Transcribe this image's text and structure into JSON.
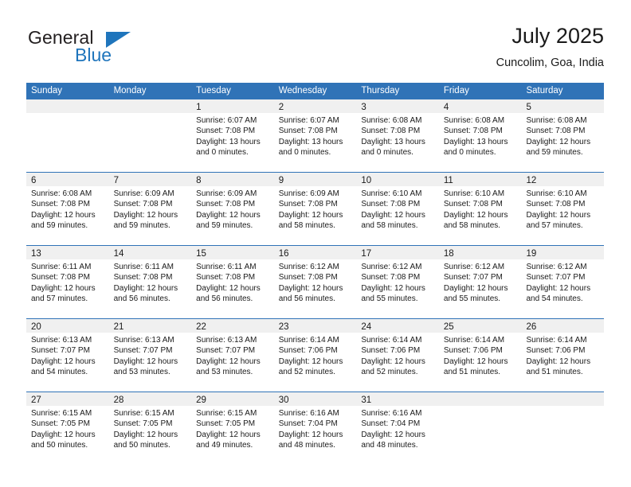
{
  "brand": {
    "name_top": "General",
    "name_bottom": "Blue",
    "triangle_icon": "triangle-icon",
    "accent_color": "#1f75bc"
  },
  "header": {
    "title": "July 2025",
    "location": "Cuncolim, Goa, India"
  },
  "theme": {
    "header_blue": "#3073b7",
    "day_strip_gray": "#f0f0f0",
    "text": "#1a1a1a"
  },
  "calendar": {
    "weekday_headers": [
      "Sunday",
      "Monday",
      "Tuesday",
      "Wednesday",
      "Thursday",
      "Friday",
      "Saturday"
    ],
    "weeks": [
      [
        {
          "day": "",
          "sunrise": "",
          "sunset": "",
          "daylight_line1": "",
          "daylight_line2": ""
        },
        {
          "day": "",
          "sunrise": "",
          "sunset": "",
          "daylight_line1": "",
          "daylight_line2": ""
        },
        {
          "day": "1",
          "sunrise": "Sunrise: 6:07 AM",
          "sunset": "Sunset: 7:08 PM",
          "daylight_line1": "Daylight: 13 hours",
          "daylight_line2": "and 0 minutes."
        },
        {
          "day": "2",
          "sunrise": "Sunrise: 6:07 AM",
          "sunset": "Sunset: 7:08 PM",
          "daylight_line1": "Daylight: 13 hours",
          "daylight_line2": "and 0 minutes."
        },
        {
          "day": "3",
          "sunrise": "Sunrise: 6:08 AM",
          "sunset": "Sunset: 7:08 PM",
          "daylight_line1": "Daylight: 13 hours",
          "daylight_line2": "and 0 minutes."
        },
        {
          "day": "4",
          "sunrise": "Sunrise: 6:08 AM",
          "sunset": "Sunset: 7:08 PM",
          "daylight_line1": "Daylight: 13 hours",
          "daylight_line2": "and 0 minutes."
        },
        {
          "day": "5",
          "sunrise": "Sunrise: 6:08 AM",
          "sunset": "Sunset: 7:08 PM",
          "daylight_line1": "Daylight: 12 hours",
          "daylight_line2": "and 59 minutes."
        }
      ],
      [
        {
          "day": "6",
          "sunrise": "Sunrise: 6:08 AM",
          "sunset": "Sunset: 7:08 PM",
          "daylight_line1": "Daylight: 12 hours",
          "daylight_line2": "and 59 minutes."
        },
        {
          "day": "7",
          "sunrise": "Sunrise: 6:09 AM",
          "sunset": "Sunset: 7:08 PM",
          "daylight_line1": "Daylight: 12 hours",
          "daylight_line2": "and 59 minutes."
        },
        {
          "day": "8",
          "sunrise": "Sunrise: 6:09 AM",
          "sunset": "Sunset: 7:08 PM",
          "daylight_line1": "Daylight: 12 hours",
          "daylight_line2": "and 59 minutes."
        },
        {
          "day": "9",
          "sunrise": "Sunrise: 6:09 AM",
          "sunset": "Sunset: 7:08 PM",
          "daylight_line1": "Daylight: 12 hours",
          "daylight_line2": "and 58 minutes."
        },
        {
          "day": "10",
          "sunrise": "Sunrise: 6:10 AM",
          "sunset": "Sunset: 7:08 PM",
          "daylight_line1": "Daylight: 12 hours",
          "daylight_line2": "and 58 minutes."
        },
        {
          "day": "11",
          "sunrise": "Sunrise: 6:10 AM",
          "sunset": "Sunset: 7:08 PM",
          "daylight_line1": "Daylight: 12 hours",
          "daylight_line2": "and 58 minutes."
        },
        {
          "day": "12",
          "sunrise": "Sunrise: 6:10 AM",
          "sunset": "Sunset: 7:08 PM",
          "daylight_line1": "Daylight: 12 hours",
          "daylight_line2": "and 57 minutes."
        }
      ],
      [
        {
          "day": "13",
          "sunrise": "Sunrise: 6:11 AM",
          "sunset": "Sunset: 7:08 PM",
          "daylight_line1": "Daylight: 12 hours",
          "daylight_line2": "and 57 minutes."
        },
        {
          "day": "14",
          "sunrise": "Sunrise: 6:11 AM",
          "sunset": "Sunset: 7:08 PM",
          "daylight_line1": "Daylight: 12 hours",
          "daylight_line2": "and 56 minutes."
        },
        {
          "day": "15",
          "sunrise": "Sunrise: 6:11 AM",
          "sunset": "Sunset: 7:08 PM",
          "daylight_line1": "Daylight: 12 hours",
          "daylight_line2": "and 56 minutes."
        },
        {
          "day": "16",
          "sunrise": "Sunrise: 6:12 AM",
          "sunset": "Sunset: 7:08 PM",
          "daylight_line1": "Daylight: 12 hours",
          "daylight_line2": "and 56 minutes."
        },
        {
          "day": "17",
          "sunrise": "Sunrise: 6:12 AM",
          "sunset": "Sunset: 7:08 PM",
          "daylight_line1": "Daylight: 12 hours",
          "daylight_line2": "and 55 minutes."
        },
        {
          "day": "18",
          "sunrise": "Sunrise: 6:12 AM",
          "sunset": "Sunset: 7:07 PM",
          "daylight_line1": "Daylight: 12 hours",
          "daylight_line2": "and 55 minutes."
        },
        {
          "day": "19",
          "sunrise": "Sunrise: 6:12 AM",
          "sunset": "Sunset: 7:07 PM",
          "daylight_line1": "Daylight: 12 hours",
          "daylight_line2": "and 54 minutes."
        }
      ],
      [
        {
          "day": "20",
          "sunrise": "Sunrise: 6:13 AM",
          "sunset": "Sunset: 7:07 PM",
          "daylight_line1": "Daylight: 12 hours",
          "daylight_line2": "and 54 minutes."
        },
        {
          "day": "21",
          "sunrise": "Sunrise: 6:13 AM",
          "sunset": "Sunset: 7:07 PM",
          "daylight_line1": "Daylight: 12 hours",
          "daylight_line2": "and 53 minutes."
        },
        {
          "day": "22",
          "sunrise": "Sunrise: 6:13 AM",
          "sunset": "Sunset: 7:07 PM",
          "daylight_line1": "Daylight: 12 hours",
          "daylight_line2": "and 53 minutes."
        },
        {
          "day": "23",
          "sunrise": "Sunrise: 6:14 AM",
          "sunset": "Sunset: 7:06 PM",
          "daylight_line1": "Daylight: 12 hours",
          "daylight_line2": "and 52 minutes."
        },
        {
          "day": "24",
          "sunrise": "Sunrise: 6:14 AM",
          "sunset": "Sunset: 7:06 PM",
          "daylight_line1": "Daylight: 12 hours",
          "daylight_line2": "and 52 minutes."
        },
        {
          "day": "25",
          "sunrise": "Sunrise: 6:14 AM",
          "sunset": "Sunset: 7:06 PM",
          "daylight_line1": "Daylight: 12 hours",
          "daylight_line2": "and 51 minutes."
        },
        {
          "day": "26",
          "sunrise": "Sunrise: 6:14 AM",
          "sunset": "Sunset: 7:06 PM",
          "daylight_line1": "Daylight: 12 hours",
          "daylight_line2": "and 51 minutes."
        }
      ],
      [
        {
          "day": "27",
          "sunrise": "Sunrise: 6:15 AM",
          "sunset": "Sunset: 7:05 PM",
          "daylight_line1": "Daylight: 12 hours",
          "daylight_line2": "and 50 minutes."
        },
        {
          "day": "28",
          "sunrise": "Sunrise: 6:15 AM",
          "sunset": "Sunset: 7:05 PM",
          "daylight_line1": "Daylight: 12 hours",
          "daylight_line2": "and 50 minutes."
        },
        {
          "day": "29",
          "sunrise": "Sunrise: 6:15 AM",
          "sunset": "Sunset: 7:05 PM",
          "daylight_line1": "Daylight: 12 hours",
          "daylight_line2": "and 49 minutes."
        },
        {
          "day": "30",
          "sunrise": "Sunrise: 6:16 AM",
          "sunset": "Sunset: 7:04 PM",
          "daylight_line1": "Daylight: 12 hours",
          "daylight_line2": "and 48 minutes."
        },
        {
          "day": "31",
          "sunrise": "Sunrise: 6:16 AM",
          "sunset": "Sunset: 7:04 PM",
          "daylight_line1": "Daylight: 12 hours",
          "daylight_line2": "and 48 minutes."
        },
        {
          "day": "",
          "sunrise": "",
          "sunset": "",
          "daylight_line1": "",
          "daylight_line2": ""
        },
        {
          "day": "",
          "sunrise": "",
          "sunset": "",
          "daylight_line1": "",
          "daylight_line2": ""
        }
      ]
    ]
  }
}
